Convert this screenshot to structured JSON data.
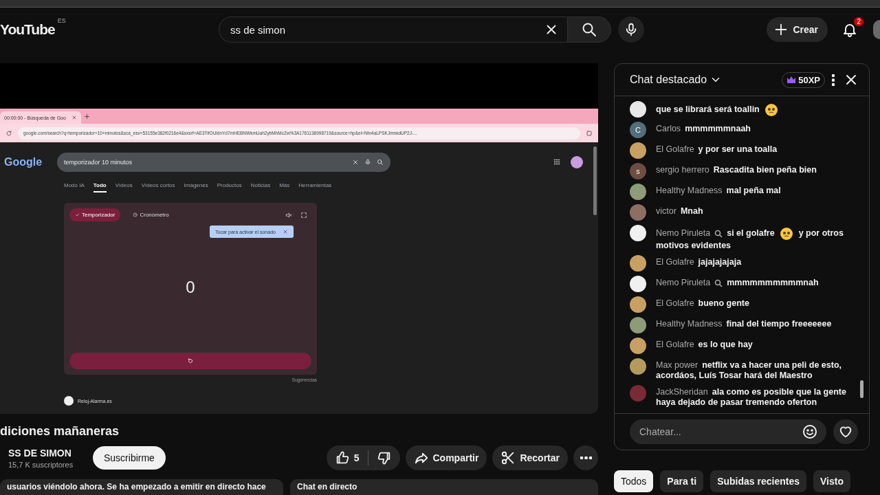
{
  "header": {
    "logo": "YouTube",
    "region": "ES",
    "search": {
      "value": "ss de simon"
    },
    "create_label": "Crear",
    "notifications": "2"
  },
  "video": {
    "browser": {
      "tab_title": "00:00:00 - Búsqueda de Goo",
      "url": "google.com/search?q=temporizador+10+minutos&sca_esv=53155e382f0216e4&sxsrf=AE3TifOUldnYd7mHEBNWkmUah2ybMhMcZw%3A1761138998719&source=hp&ei=Ntn4aLPSKJmnkdUP2J-...",
      "page": {
        "logo": "Google",
        "query": "temporizador 10 minutos",
        "tabs": [
          {
            "label": "Modo IA",
            "selected": false
          },
          {
            "label": "Todo",
            "selected": true
          },
          {
            "label": "Vídeos",
            "selected": false
          },
          {
            "label": "Vídeos cortos",
            "selected": false
          },
          {
            "label": "Imágenes",
            "selected": false
          },
          {
            "label": "Productos",
            "selected": false
          },
          {
            "label": "Noticias",
            "selected": false
          },
          {
            "label": "Más",
            "selected": false
          },
          {
            "label": "Herramientas",
            "selected": false
          }
        ],
        "timer": {
          "modes": [
            {
              "label": "Temporizador",
              "selected": true
            },
            {
              "label": "Cronómetro",
              "selected": false
            }
          ],
          "tooltip": "Tocar para activar el sonado",
          "value": "0"
        },
        "suggestions": "Sugerencias",
        "result": "Reloj-Alarma.es"
      }
    }
  },
  "title": "diciones mañaneras",
  "channel": {
    "name": "SS DE SIMON",
    "subscribers": "15,7 K suscriptores",
    "subscribe": "Suscribirme"
  },
  "actions": {
    "likes": "5",
    "share": "Compartir",
    "clip": "Recortar"
  },
  "description": "usuarios viéndolo ahora. Se ha empezado a emitir en directo hace",
  "live_chat_label": "Chat en directo",
  "chat": {
    "title": "Chat destacado",
    "points": "50XP",
    "messages": [
      {
        "kind": "continuation",
        "avatar": {
          "kind": "image",
          "color": "#e8e8e8"
        },
        "parts": [
          {
            "kind": "text",
            "text": "que se librará será toallin"
          },
          {
            "kind": "emoji"
          }
        ]
      },
      {
        "kind": "message",
        "author": "Carlos",
        "badge": false,
        "avatar": {
          "kind": "letter",
          "letter": "C",
          "color": "#546e7a"
        },
        "parts": [
          {
            "kind": "text",
            "text": "mmmmmmnaah"
          }
        ]
      },
      {
        "kind": "message",
        "author": "El Golafre",
        "badge": false,
        "avatar": {
          "kind": "image",
          "color": "#c9a063"
        },
        "parts": [
          {
            "kind": "text",
            "text": "y por ser una toalla"
          }
        ]
      },
      {
        "kind": "message",
        "author": "sergio herrero",
        "badge": false,
        "avatar": {
          "kind": "letter",
          "letter": "s",
          "color": "#6d4c41"
        },
        "parts": [
          {
            "kind": "text",
            "text": "Rascadita bien peña bien"
          }
        ]
      },
      {
        "kind": "message",
        "author": "Healthy Madness",
        "badge": false,
        "avatar": {
          "kind": "image",
          "color": "#8f9a78"
        },
        "parts": [
          {
            "kind": "text",
            "text": "mal peña mal"
          }
        ]
      },
      {
        "kind": "message",
        "author": "victor",
        "badge": false,
        "avatar": {
          "kind": "image",
          "color": "#8d6e63"
        },
        "parts": [
          {
            "kind": "text",
            "text": "Mnah"
          }
        ]
      },
      {
        "kind": "message",
        "author": "Nemo Piruleta",
        "badge": true,
        "avatar": {
          "kind": "image",
          "color": "#f0f0f0"
        },
        "parts": [
          {
            "kind": "text",
            "text": "si el golafre"
          },
          {
            "kind": "emoji"
          },
          {
            "kind": "text",
            "text": "y por otros motivos evidentes"
          }
        ]
      },
      {
        "kind": "message",
        "author": "El Golafre",
        "badge": false,
        "avatar": {
          "kind": "image",
          "color": "#c9a063"
        },
        "parts": [
          {
            "kind": "text",
            "text": "jajajajajaja"
          }
        ]
      },
      {
        "kind": "message",
        "author": "Nemo Piruleta",
        "badge": true,
        "avatar": {
          "kind": "image",
          "color": "#f0f0f0"
        },
        "parts": [
          {
            "kind": "text",
            "text": "mmmmmmmmmmnah"
          }
        ]
      },
      {
        "kind": "message",
        "author": "El Golafre",
        "badge": false,
        "avatar": {
          "kind": "image",
          "color": "#c9a063"
        },
        "parts": [
          {
            "kind": "text",
            "text": "bueno gente"
          }
        ]
      },
      {
        "kind": "message",
        "author": "Healthy Madness",
        "badge": false,
        "avatar": {
          "kind": "image",
          "color": "#8f9a78"
        },
        "parts": [
          {
            "kind": "text",
            "text": "final del tiempo freeeeeee"
          }
        ]
      },
      {
        "kind": "message",
        "author": "El Golafre",
        "badge": false,
        "avatar": {
          "kind": "image",
          "color": "#c9a063"
        },
        "parts": [
          {
            "kind": "text",
            "text": "es lo que hay"
          }
        ]
      },
      {
        "kind": "message",
        "author": "Max power",
        "badge": false,
        "avatar": {
          "kind": "image",
          "color": "#b59a5e"
        },
        "parts": [
          {
            "kind": "text",
            "text": "netflix va a hacer una peli de esto, acordáos, Luís Tosar hará del Maestro"
          }
        ]
      },
      {
        "kind": "message",
        "author": "JackSheridan",
        "badge": false,
        "avatar": {
          "kind": "image",
          "color": "#7a2a35"
        },
        "parts": [
          {
            "kind": "text",
            "text": "ala como es posible que la gente haya dejado de pasar tremendo oferton"
          }
        ]
      }
    ],
    "input": {
      "placeholder": "Chatear..."
    }
  },
  "chips": [
    {
      "label": "Todos",
      "selected": true
    },
    {
      "label": "Para ti",
      "selected": false
    },
    {
      "label": "Subidas recientes",
      "selected": false
    },
    {
      "label": "Visto",
      "selected": false
    }
  ]
}
